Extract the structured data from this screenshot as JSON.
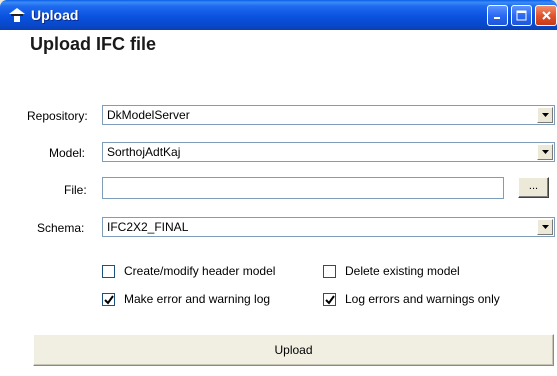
{
  "window": {
    "title": "Upload",
    "app_icon": "ifc-house-icon",
    "controls": [
      "minimize-icon",
      "maximize-icon",
      "close-icon"
    ]
  },
  "form": {
    "heading": "Upload IFC file",
    "repository": {
      "label": "Repository:",
      "value": "DkModelServer"
    },
    "model": {
      "label": "Model:",
      "value": "SorthojAdtKaj"
    },
    "file": {
      "label": "File:",
      "value": "",
      "browse_label": "..."
    },
    "schema": {
      "label": "Schema:",
      "value": "IFC2X2_FINAL"
    }
  },
  "options": {
    "create_header": {
      "label": "Create/modify header model",
      "checked": false
    },
    "delete_existing": {
      "label": "Delete existing model",
      "checked": false
    },
    "make_log": {
      "label": "Make error and warning log",
      "checked": true
    },
    "log_only": {
      "label": "Log errors and warnings only",
      "checked": true
    }
  },
  "actions": {
    "upload_label": "Upload"
  },
  "colors": {
    "titlebar": "#0b52df",
    "window_bg": "#ece9d8",
    "field_border": "#7f9db9"
  }
}
